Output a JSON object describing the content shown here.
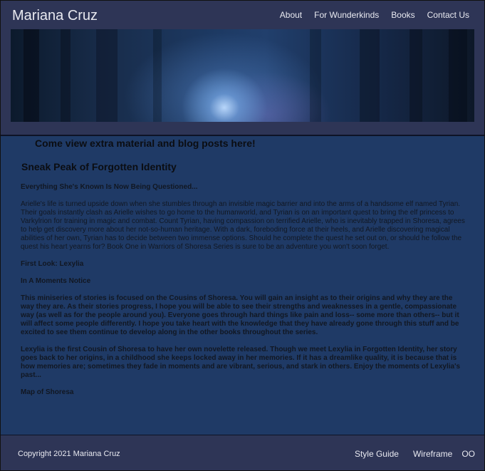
{
  "header": {
    "site_title": "Mariana Cruz",
    "nav": [
      "About",
      "For Wunderkinds",
      "Books",
      "Contact Us"
    ]
  },
  "content": {
    "callout": "Come view extra material and blog posts here!",
    "section_title": "Sneak Peak of Forgotten Identity",
    "tagline": "Everything She's Known Is Now Being Questioned...",
    "paragraph_1": "Arielle's life is turned upside down when she stumbles through an invisible magic barrier and into the arms of a handsome elf named Tyrian. Their goals instantly clash as Arielle wishes to go home to the humanworld, and Tyrian is on an important quest to bring the elf princess to Varkylrion for training in magic and combat. Count Tyrian, having compassion on terrified Arielle, who is inevitably trapped in Shoresa, agrees to help get discovery more about her not-so-human heritage. With a dark, foreboding force at their heels, and Arielle discovering magical abilities of her own, Tyrian has to decide between two immense options. Should he complete the quest he set out on, or should he follow the quest his heart yearns for? Book One in Warriors of Shoresa Series is sure to be an adventure you won't soon forget.",
    "first_look": "First Look: Lexylia",
    "in_a_moments_notice": "In A Moments Notice",
    "paragraph_2": "This miniseries of stories is focused on the Cousins of Shoresa. You will gain an insight as to their origins and why they are the way they are. As their stories progress, I hope you will be able to see their strengths and weaknesses in a gentle, compassionate way (as well as for the people around you). Everyone goes through hard things like pain and loss-- some more than others-- but it will affect some people differently. I hope you take heart with the knowledge that they have already gone through this stuff and be excited to see them continue to develop along in the other books throughout the series.",
    "paragraph_3": "Lexylia is the first Cousin of Shoresa to have her own novelette released. Though we meet Lexylia in Forgotten Identity, her story goes back to her origins, in a childhood she keeps locked away in her memories. If it has a dreamlike quality, it is because that is how memories are; sometimes they fade in moments and are vibrant, serious, and stark in others. Enjoy the moments of Lexylia's past...",
    "map_heading": "Map of Shoresa"
  },
  "footer": {
    "copyright": "Copyright 2021 Mariana Cruz",
    "links": [
      "Style Guide",
      "Wireframe",
      "OO"
    ]
  }
}
